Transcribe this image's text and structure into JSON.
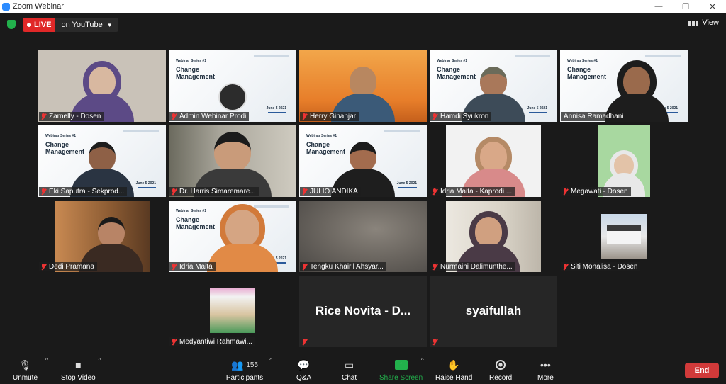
{
  "window": {
    "title": "Zoom Webinar",
    "controls": [
      "—",
      "❐",
      "✕"
    ]
  },
  "topbar": {
    "live_label": "LIVE",
    "live_destination": "on YouTube",
    "view_label": "View"
  },
  "slide": {
    "series": "Webinar Series #1",
    "title_line1": "Change",
    "title_line2": "Management",
    "date": "June 5 2021"
  },
  "participants": [
    {
      "name": "Zarnelly - Dosen"
    },
    {
      "name": "Admin Webinar Prodi"
    },
    {
      "name": "Herry Ginanjar"
    },
    {
      "name": "Hamdi Syukron"
    },
    {
      "name": "Annisa Ramadhani"
    },
    {
      "name": "Eki Saputra - Sekprod..."
    },
    {
      "name": "Dr. Harris Simaremare..."
    },
    {
      "name": "JULIO ANDIKA"
    },
    {
      "name": "Idria Maita - Kaprodi ..."
    },
    {
      "name": "Megawati - Dosen"
    },
    {
      "name": "Dedi Pramana"
    },
    {
      "name": "Idria Maita"
    },
    {
      "name": "Tengku Khairil Ahsyar..."
    },
    {
      "name": "Nurmaini Dalimunthe..."
    },
    {
      "name": "Siti Monalisa - Dosen"
    },
    {
      "name": "Medyantiwi Rahmawi..."
    },
    {
      "name": "",
      "display_name": "Rice Novita - D..."
    },
    {
      "name": "",
      "display_name": "syaifullah"
    }
  ],
  "toolbar": {
    "unmute": "Unmute",
    "stop_video": "Stop Video",
    "participants": "Participants",
    "participants_count": "155",
    "qa": "Q&A",
    "chat": "Chat",
    "share_screen": "Share Screen",
    "raise_hand": "Raise Hand",
    "record": "Record",
    "more": "More",
    "end": "End"
  },
  "colors": {
    "live_red": "#e02828",
    "share_green": "#22b14c",
    "end_red": "#d13a3a",
    "active_speaker": "#c6e65a"
  }
}
